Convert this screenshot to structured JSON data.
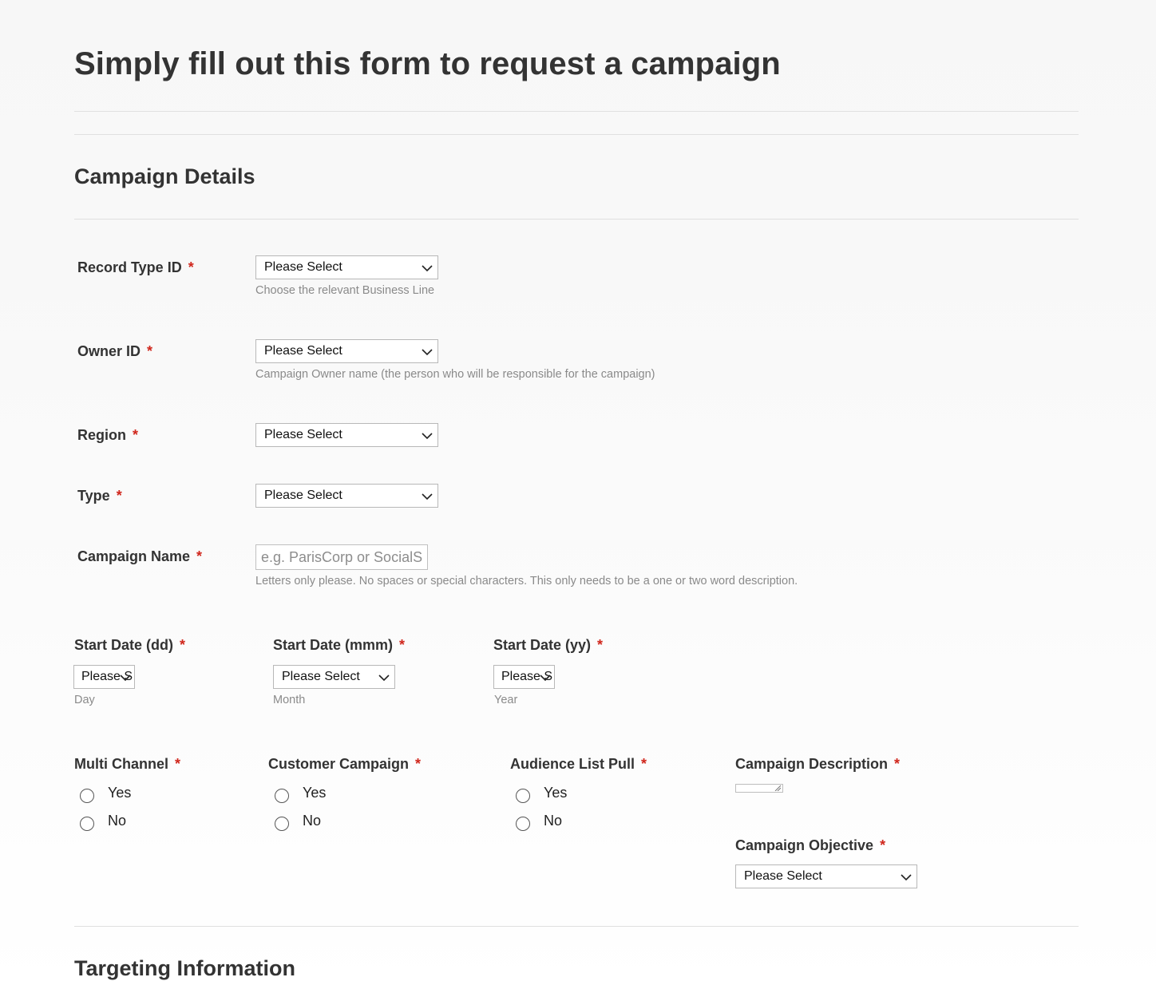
{
  "page": {
    "title": "Simply fill out this form to request a campaign"
  },
  "sections": {
    "campaign_details": "Campaign Details",
    "targeting_information": "Targeting Information"
  },
  "required_mark": "*",
  "fields": {
    "record_type": {
      "label": "Record Type ID",
      "value": "Please Select",
      "hint": "Choose the relevant Business Line"
    },
    "owner": {
      "label": "Owner ID",
      "value": "Please Select",
      "hint": "Campaign Owner name (the person who will be responsible for the campaign)"
    },
    "region": {
      "label": "Region",
      "value": "Please Select"
    },
    "type": {
      "label": "Type",
      "value": "Please Select"
    },
    "campaign_name": {
      "label": "Campaign Name",
      "placeholder": "e.g. ParisCorp or SocialS",
      "hint": "Letters only please. No spaces or special characters. This only needs to be a one or two word description."
    },
    "start_day": {
      "label": "Start Date (dd)",
      "value": "Please S",
      "hint": "Day"
    },
    "start_month": {
      "label": "Start Date (mmm)",
      "value": "Please Select",
      "hint": "Month"
    },
    "start_year": {
      "label": "Start Date (yy)",
      "value": "Please S",
      "hint": "Year"
    },
    "multi_channel": {
      "label": "Multi Channel",
      "options": [
        "Yes",
        "No"
      ]
    },
    "customer_campaign": {
      "label": "Customer Campaign",
      "options": [
        "Yes",
        "No"
      ]
    },
    "audience_list_pull": {
      "label": "Audience List Pull",
      "options": [
        "Yes",
        "No"
      ]
    },
    "campaign_description": {
      "label": "Campaign Description"
    },
    "campaign_objective": {
      "label": "Campaign Objective",
      "value": "Please Select"
    }
  },
  "icons": {
    "dropdown": "chevron-down-icon",
    "resize": "resize-grip-icon"
  },
  "colors": {
    "required": "#d0261c",
    "hint": "#8a8a8a",
    "text": "#333333"
  }
}
